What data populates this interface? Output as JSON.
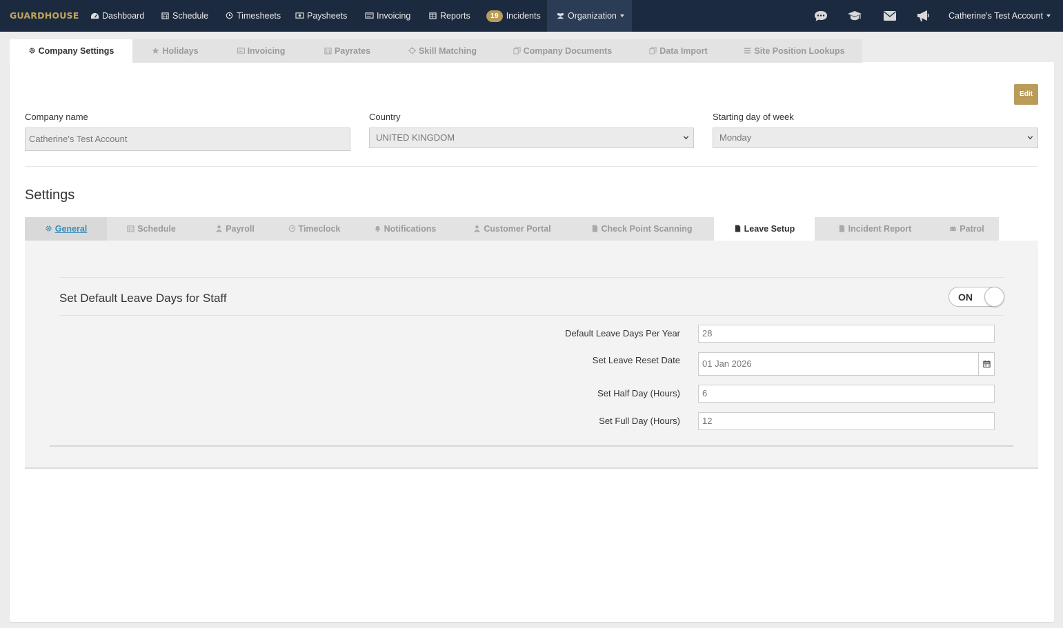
{
  "navbar": {
    "brand": "GUARDHOUSE",
    "items": [
      {
        "label": "Dashboard",
        "icon": "dashboard-icon"
      },
      {
        "label": "Schedule",
        "icon": "calendar-icon"
      },
      {
        "label": "Timesheets",
        "icon": "clock-icon"
      },
      {
        "label": "Paysheets",
        "icon": "money-icon"
      },
      {
        "label": "Invoicing",
        "icon": "invoice-icon"
      },
      {
        "label": "Reports",
        "icon": "table-icon"
      },
      {
        "label": "Incidents",
        "badge": "19"
      },
      {
        "label": "Organization",
        "icon": "users-icon"
      }
    ],
    "right_icons": [
      "chat-icon",
      "graduation-cap-icon",
      "envelope-icon",
      "bullhorn-icon"
    ],
    "account": "Catherine's Test Account"
  },
  "top_tabs": [
    {
      "label": "Company Settings",
      "icon": "gear-icon",
      "active": true
    },
    {
      "label": "Holidays",
      "icon": "star-icon"
    },
    {
      "label": "Invoicing",
      "icon": "invoice-icon"
    },
    {
      "label": "Payrates",
      "icon": "calendar-icon"
    },
    {
      "label": "Skill Matching",
      "icon": "crosshair-icon"
    },
    {
      "label": "Company Documents",
      "icon": "copy-icon"
    },
    {
      "label": "Data Import",
      "icon": "copy-icon"
    },
    {
      "label": "Site Position Lookups",
      "icon": "list-icon"
    }
  ],
  "edit_label": "Edit",
  "company": {
    "name_label": "Company name",
    "name_value": "Catherine's Test Account",
    "country_label": "Country",
    "country_value": "UNITED KINGDOM",
    "start_day_label": "Starting day of week",
    "start_day_value": "Monday"
  },
  "settings_heading": "Settings",
  "settings_tabs": [
    {
      "label": "General",
      "icon": "gear-icon"
    },
    {
      "label": "Schedule",
      "icon": "calendar-icon"
    },
    {
      "label": "Payroll",
      "icon": "user-icon"
    },
    {
      "label": "Timeclock",
      "icon": "clock-icon"
    },
    {
      "label": "Notifications",
      "icon": "bell-icon"
    },
    {
      "label": "Customer Portal",
      "icon": "user-icon"
    },
    {
      "label": "Check Point Scanning",
      "icon": "file-icon"
    },
    {
      "label": "Leave Setup",
      "icon": "file-icon",
      "active": true
    },
    {
      "label": "Incident Report",
      "icon": "file-icon"
    },
    {
      "label": "Patrol",
      "icon": "car-icon"
    }
  ],
  "leave": {
    "title": "Set Default Leave Days for Staff",
    "toggle": "ON",
    "rows": [
      {
        "label": "Default Leave Days Per Year",
        "value": "28"
      },
      {
        "label": "Set Leave Reset Date",
        "value": "01 Jan 2026"
      },
      {
        "label": "Set Half Day (Hours)",
        "value": "6"
      },
      {
        "label": "Set Full Day (Hours)",
        "value": "12"
      }
    ]
  },
  "colors": {
    "navbar": "#1c2a3f",
    "accent": "#b99c5a",
    "link": "#3c8dbc"
  }
}
